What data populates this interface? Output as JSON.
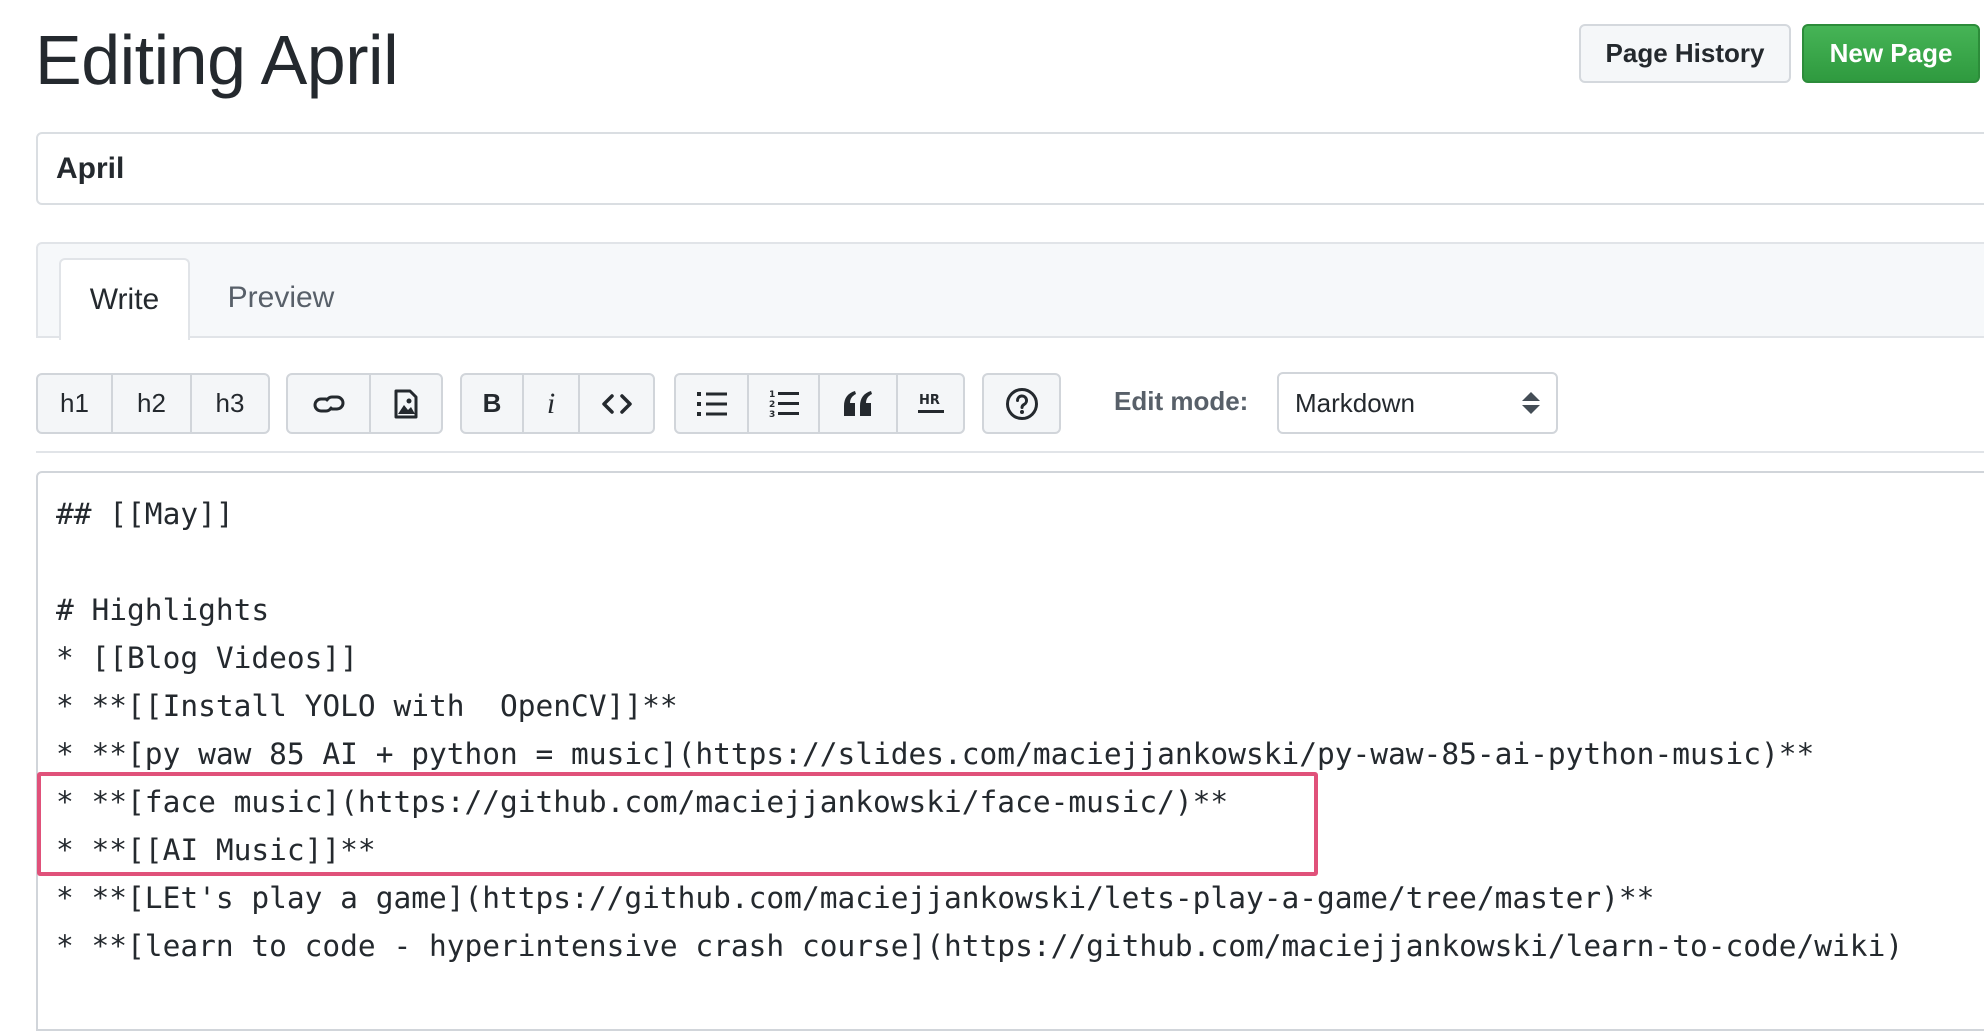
{
  "header": {
    "title": "Editing April",
    "page_history_label": "Page History",
    "new_page_label": "New Page"
  },
  "page_name": {
    "value": "April"
  },
  "tabs": {
    "write": "Write",
    "preview": "Preview"
  },
  "toolbar": {
    "h1": "h1",
    "h2": "h2",
    "h3": "h3",
    "bold": "B",
    "italic": "i",
    "code_icon": "code-icon",
    "link_icon": "link-icon",
    "image_icon": "image-icon",
    "ul_icon": "unordered-list-icon",
    "ol_icon": "ordered-list-icon",
    "quote_icon": "blockquote-icon",
    "hr_icon": "horizontal-rule-icon",
    "help_icon": "help-icon",
    "edit_mode_label": "Edit mode:",
    "edit_mode_value": "Markdown"
  },
  "editor": {
    "lines": [
      "## [[May]]",
      "",
      "# Highlights",
      "* [[Blog Videos]]",
      "* **[[Install YOLO with  OpenCV]]**",
      "* **[py waw 85 AI + python = music](https://slides.com/maciejjankowski/py-waw-85-ai-python-music)**",
      "* **[face music](https://github.com/maciejjankowski/face-music/)**",
      "* **[[AI Music]]**",
      "* **[LEt's play a game](https://github.com/maciejjankowski/lets-play-a-game/tree/master)**",
      "* **[learn to code - hyperintensive crash course](https://github.com/maciejjankowski/learn-to-code/wiki)"
    ]
  },
  "colors": {
    "accent_green": "#36a248",
    "highlight_pink": "#e0517a",
    "border": "#d1d5da"
  }
}
